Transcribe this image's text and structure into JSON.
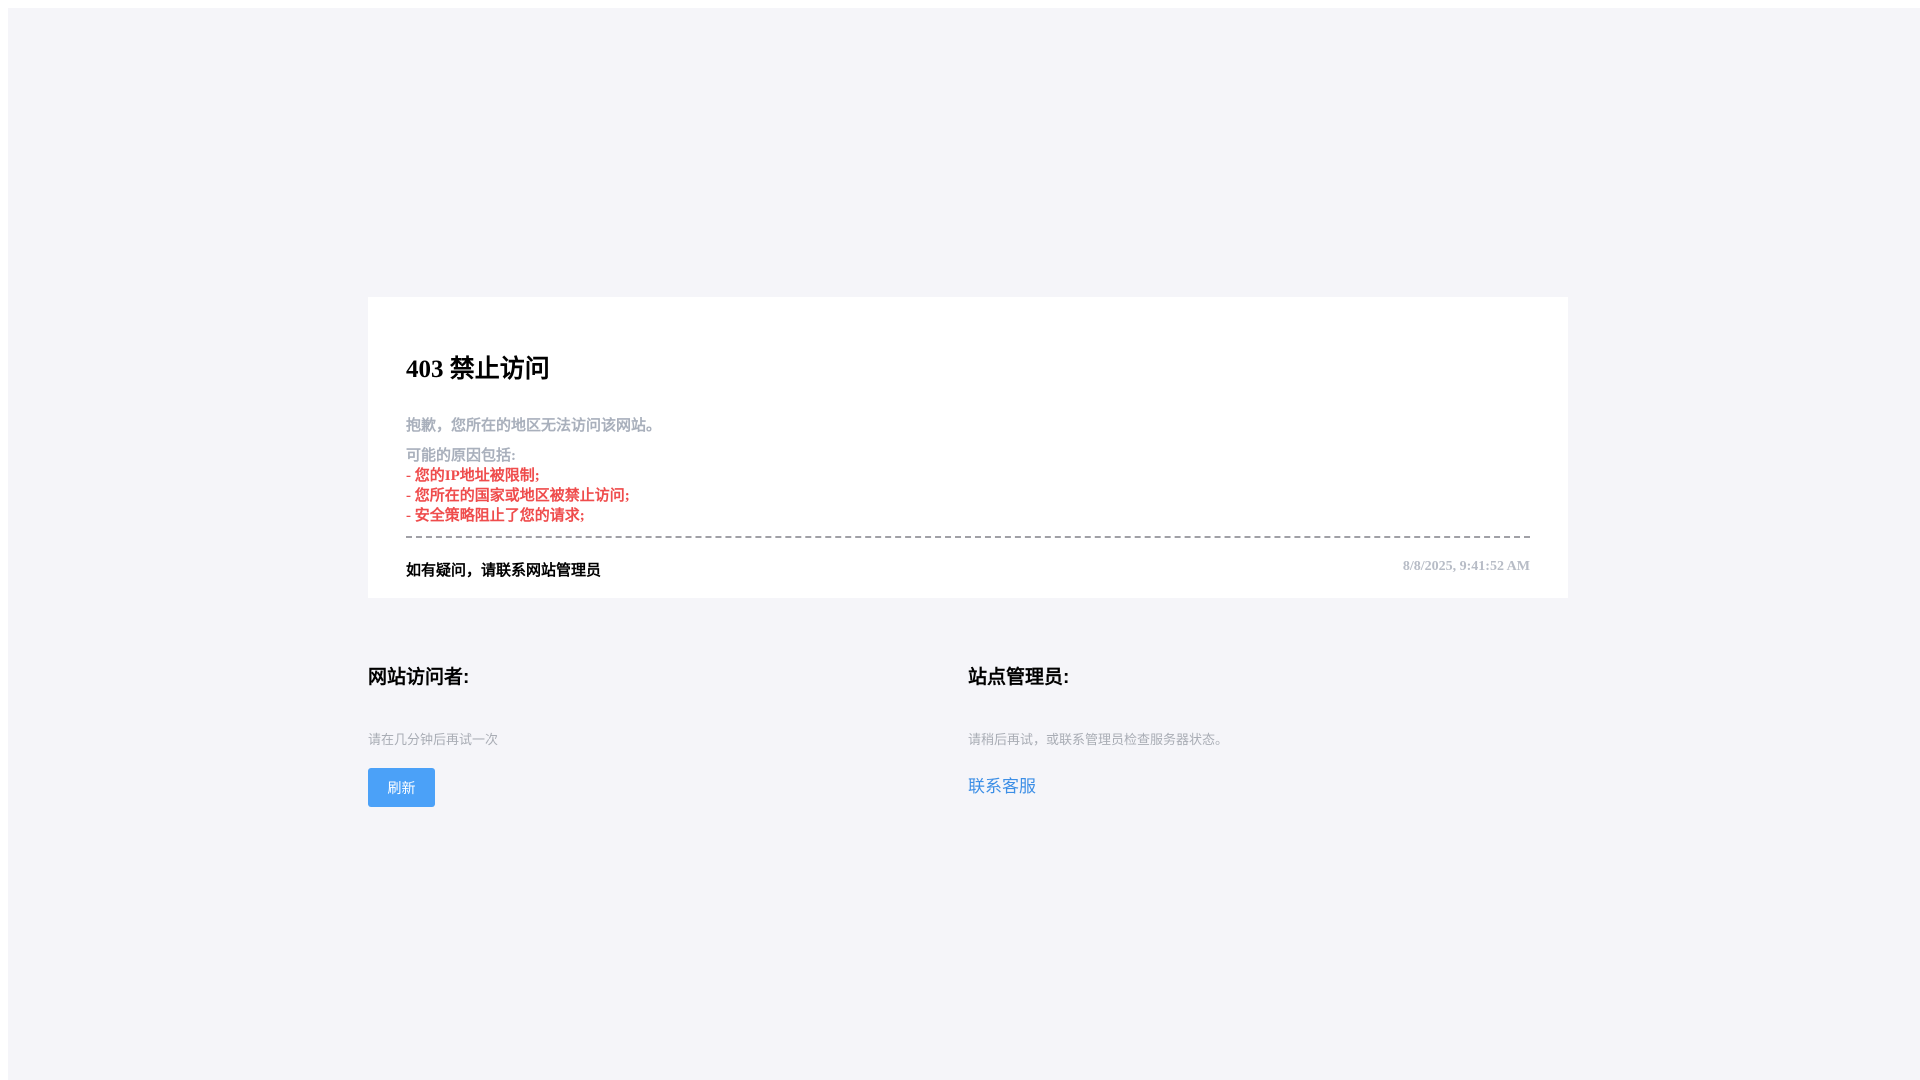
{
  "card": {
    "title": "403 禁止访问",
    "message": "抱歉，您所在的地区无法访问该网站。",
    "reasons_heading": "可能的原因包括:",
    "reasons": [
      "- 您的IP地址被限制;",
      "- 您所在的国家或地区被禁止访问;",
      "- 安全策略阻止了您的请求;"
    ],
    "contact_note": "如有疑问，请联系网站管理员",
    "timestamp": "8/8/2025, 9:41:52 AM"
  },
  "visitor": {
    "title": "网站访问者:",
    "description": "请在几分钟后再试一次",
    "refresh_label": "刷新"
  },
  "admin": {
    "title": "站点管理员:",
    "description": "请稍后再试，或联系管理员检查服务器状态。",
    "support_label": "联系客服"
  },
  "colors": {
    "page_background": "#f5f5f9",
    "reason_text": "#ef4c4c",
    "button": "#4ba1f8",
    "link": "#3d8fe6"
  }
}
